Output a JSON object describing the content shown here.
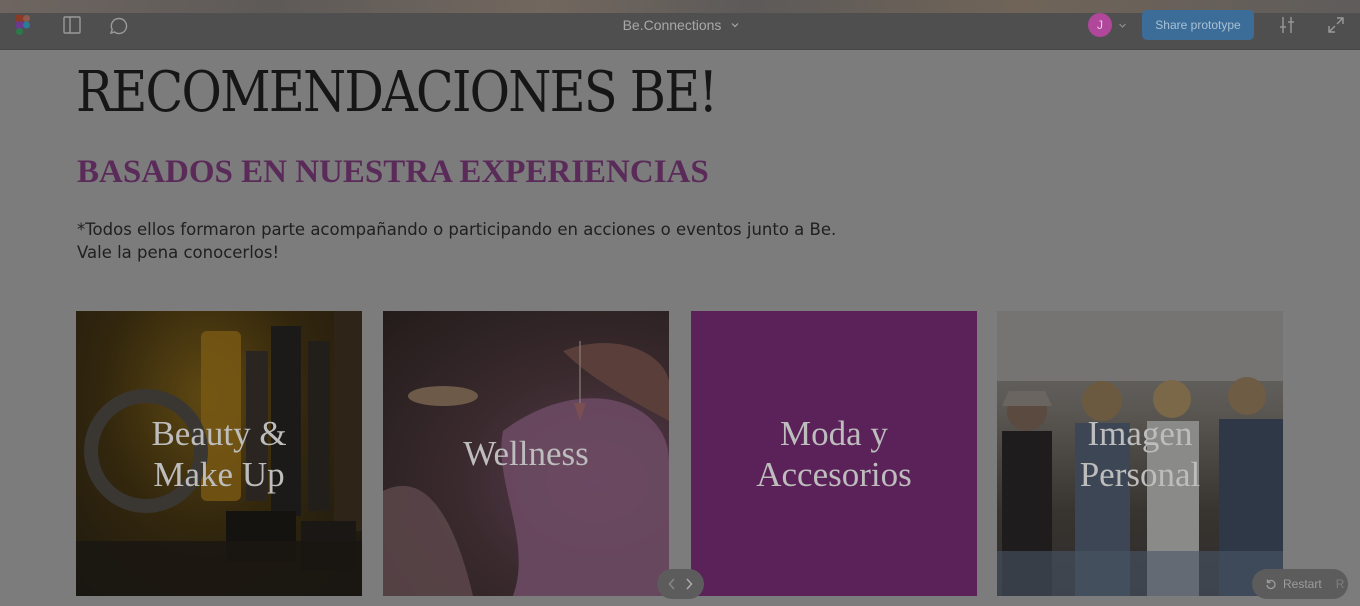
{
  "toolbar": {
    "file_title": "Be.Connections",
    "avatar_initial": "J",
    "avatar_color": "#b0479b",
    "share_label": "Share prototype",
    "share_color": "#3b6d98",
    "icons": [
      "figma-logo-icon",
      "panel-icon",
      "comment-icon",
      "chevron-down-icon",
      "settings-sliders-icon",
      "expand-icon"
    ]
  },
  "page": {
    "heading": "RECOMENDACIONES BE!",
    "subheading": "BASADOS EN NUESTRA EXPERIENCIAS",
    "subheading_color": "#5a2a59",
    "intro_line1": "*Todos ellos formaron parte acompañando o participando en acciones o eventos junto a Be.",
    "intro_line2": "Vale la pena conocerlos!"
  },
  "cards": [
    {
      "line1": "Beauty &",
      "line2": "Make Up"
    },
    {
      "line1": "Wellness"
    },
    {
      "line1": "Moda y",
      "line2": "Accesorios",
      "color": "#5b2159"
    },
    {
      "line1": "Imagen",
      "line2": "Personal"
    }
  ],
  "controls": {
    "restart_label": "Restart",
    "restart_key": "R"
  }
}
